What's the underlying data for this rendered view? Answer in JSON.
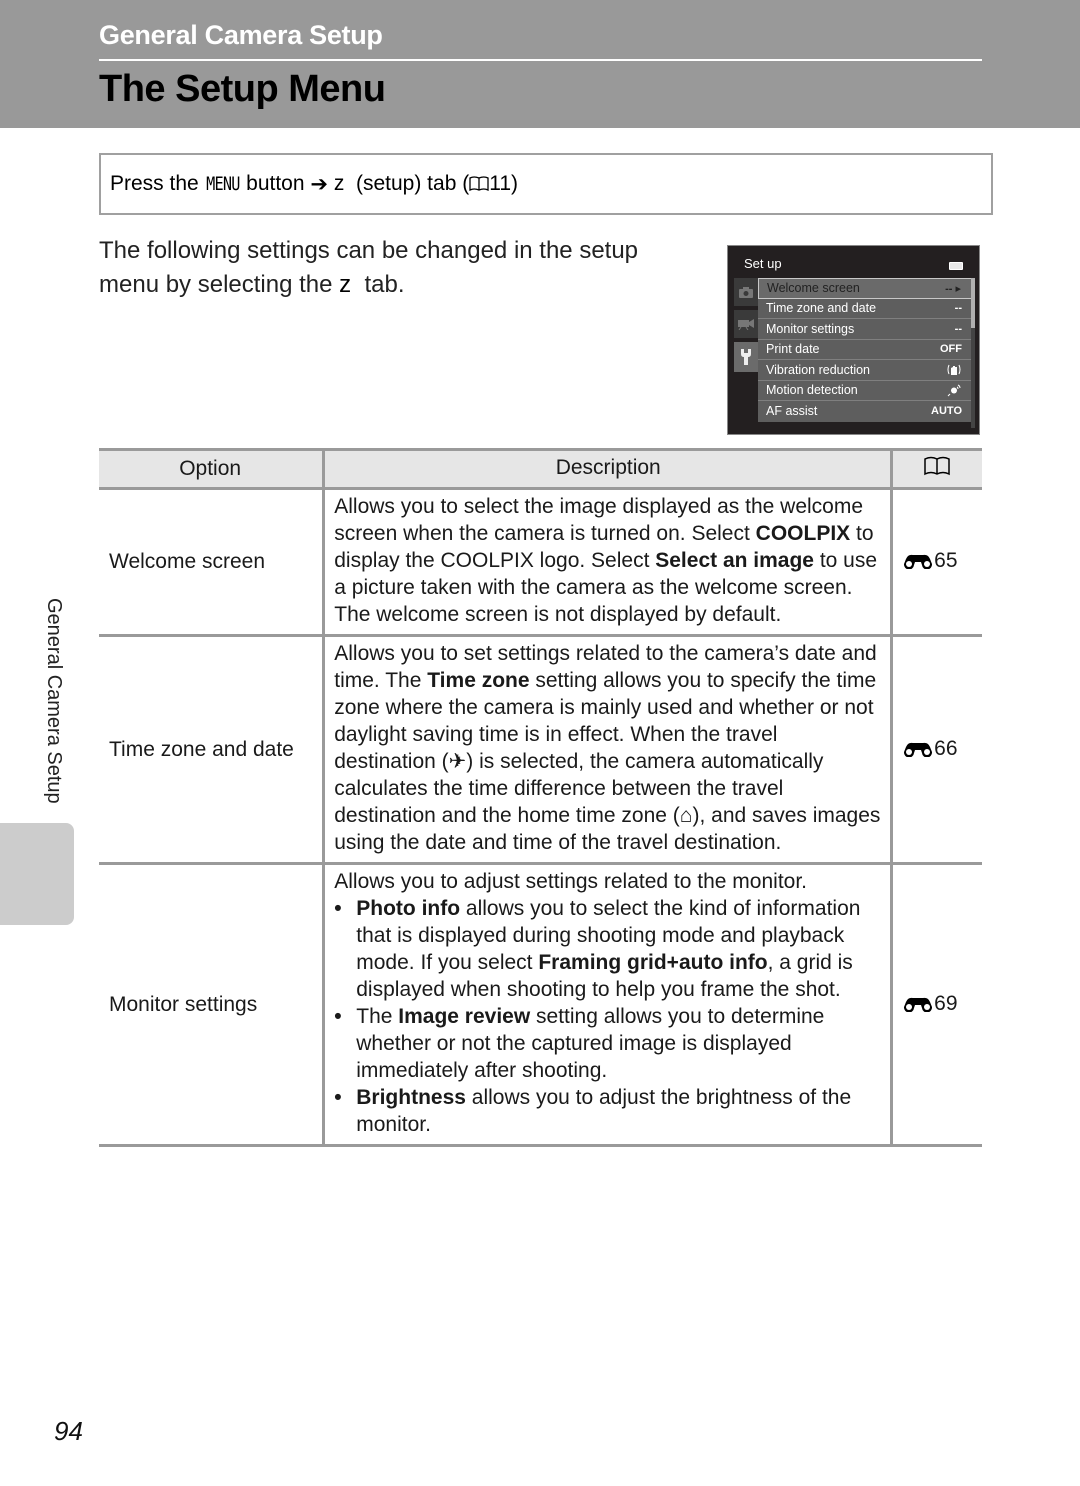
{
  "header": {
    "section": "General Camera Setup",
    "title": "The Setup Menu"
  },
  "nav": {
    "press_the": "Press the ",
    "menu_key": "MENU",
    "button": " button ",
    "arrow": "➔",
    "tab_glyph": " z ",
    "setup_tab": " (setup) tab (",
    "book_ref": "11",
    "close": ")"
  },
  "intro": {
    "line1": "The following settings can be changed in the setup",
    "line2_pre": "menu by selecting the ",
    "tab_glyph": "z",
    "line2_post": "  tab."
  },
  "camera_screen": {
    "title": "Set up",
    "tabs": [
      {
        "icon": "camera-icon",
        "active": false
      },
      {
        "icon": "movie-icon",
        "active": false
      },
      {
        "icon": "wrench-icon",
        "active": true
      }
    ],
    "items": [
      {
        "label": "Welcome screen",
        "value": "-- ▸",
        "selected": true
      },
      {
        "label": "Time zone and date",
        "value": "--"
      },
      {
        "label": "Monitor settings",
        "value": "--"
      },
      {
        "label": "Print date",
        "value": "OFF"
      },
      {
        "label": "Vibration reduction",
        "value": "vr-icon"
      },
      {
        "label": "Motion detection",
        "value": "motion-icon"
      },
      {
        "label": "AF assist",
        "value": "AUTO"
      }
    ]
  },
  "table": {
    "headers": {
      "option": "Option",
      "description": "Description",
      "ref": "book-icon"
    },
    "rows": [
      {
        "option": "Welcome screen",
        "desc": [
          {
            "t": "Allows you to select the image displayed as the welcome screen when the camera is turned on. Select "
          },
          {
            "b": "COOLPIX"
          },
          {
            "t": " to display the COOLPIX logo. Select "
          },
          {
            "b": "Select an image"
          },
          {
            "t": " to use a picture taken with the camera as the welcome screen. The welcome screen is not displayed by default."
          }
        ],
        "ref": "65"
      },
      {
        "option": "Time zone and date",
        "desc": [
          {
            "t": "Allows you to set settings related to the camera’s date and time. The "
          },
          {
            "b": "Time zone"
          },
          {
            "t": " setting allows you to specify the time zone where the camera is mainly used and whether or not daylight saving time is in effect. When the travel destination ("
          },
          {
            "icon": "✈"
          },
          {
            "t": ") is selected, the camera automatically calculates the time difference between the travel destination and the home time zone ("
          },
          {
            "icon": "⌂"
          },
          {
            "t": "), and saves images using the date and time of the travel destination."
          }
        ],
        "ref": "66"
      },
      {
        "option": "Monitor settings",
        "intro": "Allows you to adjust settings related to the monitor.",
        "bullets": [
          [
            {
              "b": "Photo info"
            },
            {
              "t": " allows you to select the kind of information that is displayed during shooting mode and playback mode. If you select "
            },
            {
              "b": "Framing grid+auto info"
            },
            {
              "t": ", a grid is displayed when shooting to help you frame the shot."
            }
          ],
          [
            {
              "t": "The "
            },
            {
              "b": "Image review"
            },
            {
              "t": " setting allows you to determine whether or not the captured image is displayed immediately after shooting."
            }
          ],
          [
            {
              "b": "Brightness"
            },
            {
              "t": " allows you to adjust the brightness of the monitor."
            }
          ]
        ],
        "ref": "69"
      }
    ]
  },
  "side_label": "General Camera Setup",
  "page_number": "94"
}
